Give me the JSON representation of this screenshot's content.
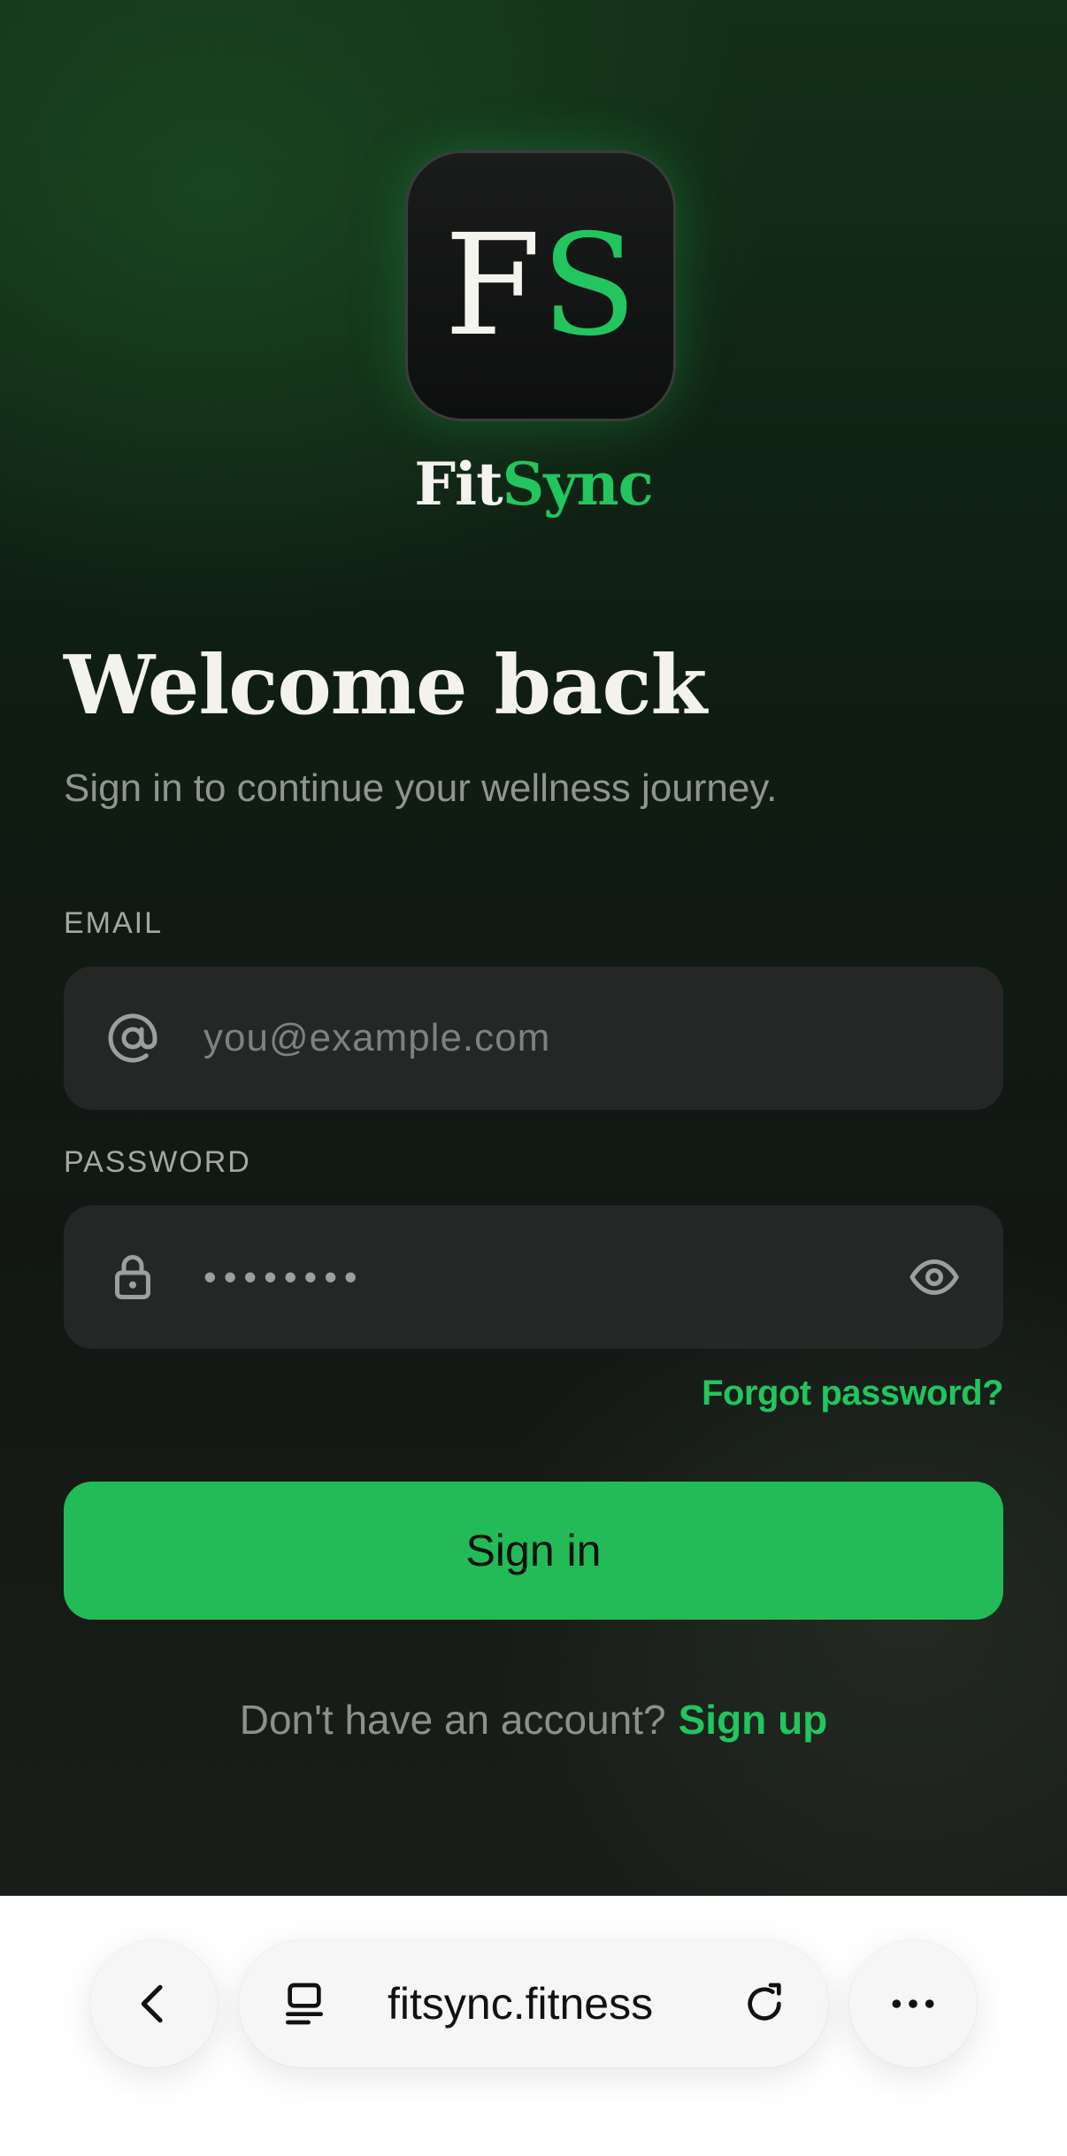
{
  "app": {
    "logo": {
      "letter1": "F",
      "letter2": "S"
    },
    "brand": {
      "part1": "Fit",
      "part2": "Sync"
    },
    "title": "Welcome back",
    "subtitle": "Sign in to continue your wellness journey.",
    "email": {
      "label": "EMAIL",
      "placeholder": "you@example.com"
    },
    "password": {
      "label": "PASSWORD",
      "masked_value": "••••••••"
    },
    "forgot_label": "Forgot password?",
    "signin_label": "Sign in",
    "signup_prompt": "Don't have an account?",
    "signup_label": "Sign up"
  },
  "browser": {
    "url": "fitsync.fitness",
    "icons": [
      "chevron-left-icon",
      "tabs-icon",
      "reload-icon",
      "more-icon"
    ]
  },
  "colors": {
    "accent": "#22c55e",
    "button": "#22bb57",
    "text_primary": "#f4f2ec",
    "text_muted": "#8f9590"
  }
}
